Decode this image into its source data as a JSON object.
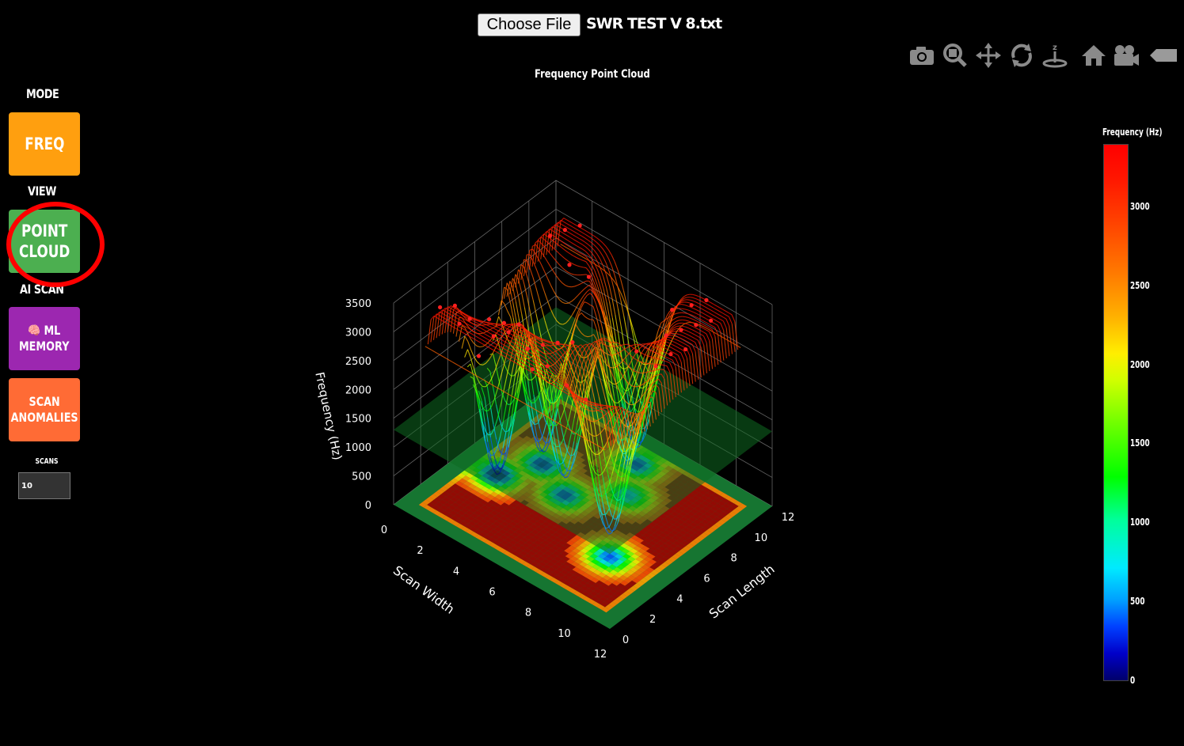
{
  "header": {
    "choose_file_label": "Choose File",
    "file_name": "SWR TEST V 8.txt"
  },
  "sidebar": {
    "mode_label": "MODE",
    "freq_button": "FREQ",
    "view_label": "VIEW",
    "point_cloud_line1": "POINT",
    "point_cloud_line2": "CLOUD",
    "ai_scan_label": "AI SCAN",
    "ml_memory_line1": "🧠 ML",
    "ml_memory_line2": "MEMORY",
    "scan_anomalies_line1": "SCAN",
    "scan_anomalies_line2": "ANOMALIES",
    "scans_label": "SCANS",
    "scans_value": "10"
  },
  "colors": {
    "freq_button": "#ff9f0f",
    "point_cloud_button": "#4caf50",
    "ml_memory_button": "#9c27b0",
    "scan_anomalies_button": "#ff6b35",
    "highlight_ring": "#ff0000"
  },
  "toolbar": {
    "icons": [
      "camera-icon",
      "zoom-icon",
      "pan-icon",
      "orbit-rotate-icon",
      "turntable-rotate-icon",
      "home-icon",
      "camera-view-icon",
      "logo-icon"
    ]
  },
  "chart_data": {
    "type": "surface",
    "title": "Frequency Point Cloud",
    "xlabel": "Scan Width",
    "ylabel": "Scan Length",
    "zlabel": "Frequency (Hz)",
    "x_ticks": [
      "0",
      "2",
      "4",
      "6",
      "8",
      "10",
      "12"
    ],
    "y_ticks": [
      "0",
      "2",
      "4",
      "6",
      "8",
      "10",
      "12"
    ],
    "z_ticks": [
      "0",
      "500",
      "1000",
      "1500",
      "2000",
      "2500",
      "3000",
      "3500"
    ],
    "xlim": [
      0,
      12
    ],
    "ylim": [
      0,
      12
    ],
    "zlim": [
      0,
      3500
    ],
    "colorbar": {
      "title": "Frequency (Hz)",
      "ticks": [
        "0",
        "500",
        "1000",
        "1500",
        "2000",
        "2500",
        "3000"
      ],
      "range": [
        0,
        3400
      ],
      "colorscale": "jet"
    },
    "baseline_frequency": 3300,
    "dips": [
      {
        "x": 2,
        "y": 5,
        "min_frequency": 0
      },
      {
        "x": 3,
        "y": 7,
        "min_frequency": 200
      },
      {
        "x": 5,
        "y": 6,
        "min_frequency": 300
      },
      {
        "x": 7,
        "y": 8,
        "min_frequency": 600
      },
      {
        "x": 6,
        "y": 10,
        "min_frequency": 300
      },
      {
        "x": 9,
        "y": 4,
        "min_frequency": 400
      }
    ]
  }
}
